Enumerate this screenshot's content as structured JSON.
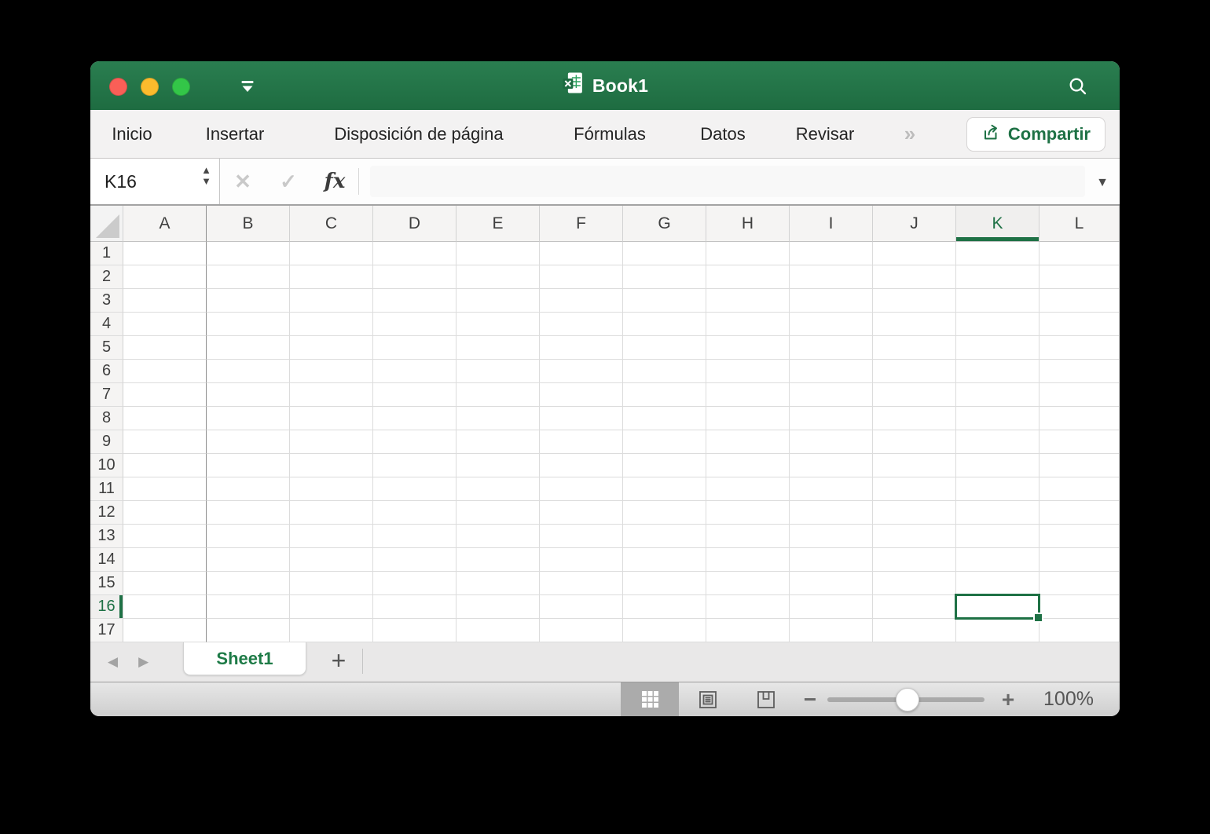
{
  "titlebar": {
    "title": "Book1",
    "traffic_lights": {
      "close": "#f95f57",
      "minimize": "#fcbb2d",
      "zoom": "#33c648"
    }
  },
  "ribbon": {
    "tabs": [
      "Inicio",
      "Insertar",
      "Disposición de página",
      "Fórmulas",
      "Datos",
      "Revisar"
    ],
    "overflow_glyph": "»",
    "share_label": "Compartir"
  },
  "formula_bar": {
    "name_box_value": "K16",
    "formula_value": "",
    "stepper_up_glyph": "▲",
    "stepper_down_glyph": "▼",
    "cancel_glyph": "✕",
    "enter_glyph": "✓",
    "fx_glyph": "fx",
    "dropdown_glyph": "▼"
  },
  "grid": {
    "columns": [
      "A",
      "B",
      "C",
      "D",
      "E",
      "F",
      "G",
      "H",
      "I",
      "J",
      "K",
      "L"
    ],
    "rows": [
      "1",
      "2",
      "3",
      "4",
      "5",
      "6",
      "7",
      "8",
      "9",
      "10",
      "11",
      "12",
      "13",
      "14",
      "15",
      "16",
      "17"
    ],
    "selected": {
      "cell": "K16",
      "column": "K",
      "row": "16"
    }
  },
  "sheet_bar": {
    "nav_left_glyph": "◀",
    "nav_right_glyph": "▶",
    "tabs": [
      {
        "label": "Sheet1",
        "active": true
      }
    ],
    "add_glyph": "+"
  },
  "status_bar": {
    "zoom_out_glyph": "−",
    "zoom_in_glyph": "+",
    "zoom_level": "100%"
  },
  "colors": {
    "accent_green": "#1e7145",
    "titlebar_green_top": "#2a7e50",
    "titlebar_green_bottom": "#1e6c41",
    "selection_green": "#1e7145"
  }
}
